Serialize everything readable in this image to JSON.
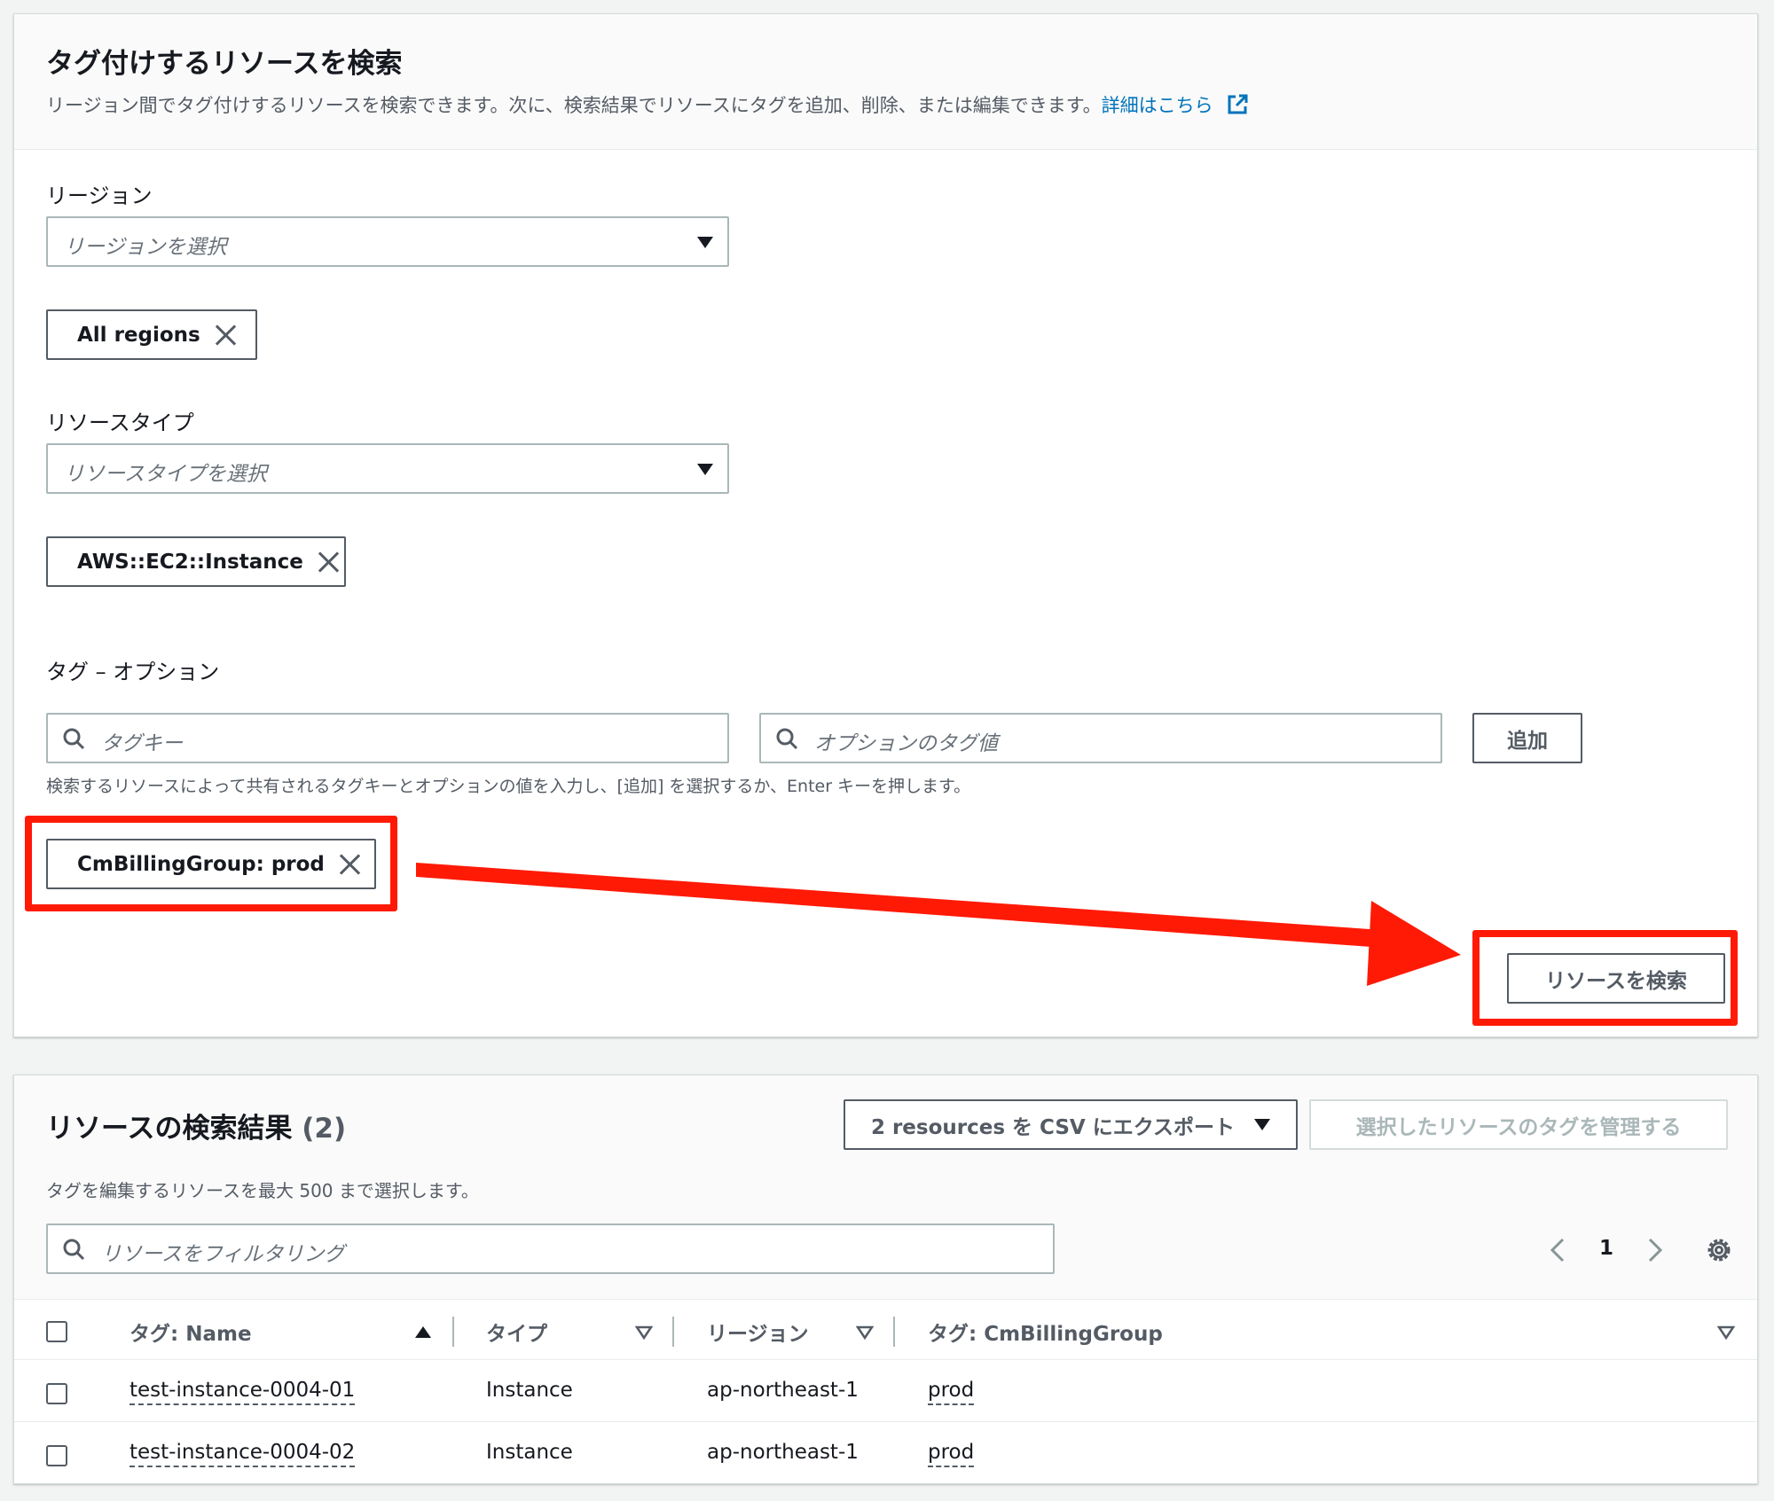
{
  "search": {
    "title": "タグ付けするリソースを検索",
    "description": "リージョン間でタグ付けするリソースを検索できます。次に、検索結果でリソースにタグを追加、削除、または編集できます。",
    "learn_more": "詳細はこちら",
    "region_label": "リージョン",
    "region_placeholder": "リージョンを選択",
    "region_token": "All regions",
    "resource_type_label": "リソースタイプ",
    "resource_type_placeholder": "リソースタイプを選択",
    "resource_type_token": "AWS::EC2::Instance",
    "tags_label": "タグ – オプション",
    "tag_key_placeholder": "タグキー",
    "tag_value_placeholder": "オプションのタグ値",
    "add_button": "追加",
    "tags_hint": "検索するリソースによって共有されるタグキーとオプションの値を入力し、[追加] を選択するか、Enter キーを押します。",
    "tag_token": "CmBillingGroup: prod",
    "search_button": "リソースを検索"
  },
  "results": {
    "title": "リソースの検索結果",
    "count": "(2)",
    "export_button": "2 resources を CSV にエクスポート",
    "manage_button": "選択したリソースのタグを管理する",
    "subtitle": "タグを編集するリソースを最大 500 まで選択します。",
    "filter_placeholder": "リソースをフィルタリング",
    "page": "1",
    "columns": [
      "タグ: Name",
      "タイプ",
      "リージョン",
      "タグ: CmBillingGroup"
    ],
    "rows": [
      {
        "name": "test-instance-0004-01",
        "type": "Instance",
        "region": "ap-northeast-1",
        "group": "prod"
      },
      {
        "name": "test-instance-0004-02",
        "type": "Instance",
        "region": "ap-northeast-1",
        "group": "prod"
      }
    ]
  },
  "colors": {
    "highlight": "#ff1a06",
    "link": "#0073bb"
  }
}
